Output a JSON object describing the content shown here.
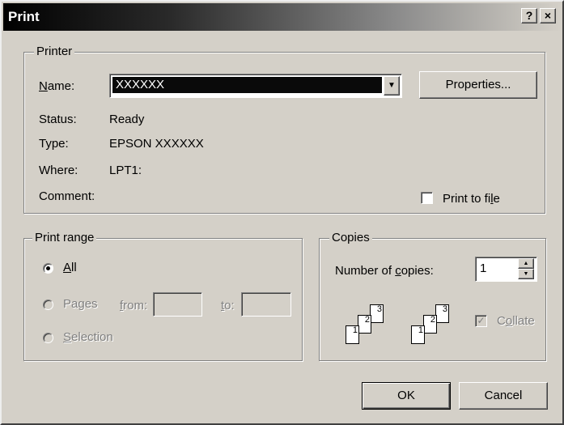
{
  "window": {
    "title": "Print",
    "help_glyph": "?",
    "close_glyph": "×"
  },
  "printer": {
    "group_label": "Printer",
    "name_label": "Name:",
    "name_value": "XXXXXX",
    "dropdown_glyph": "▼",
    "properties_label": "Properties...",
    "status_label": "Status:",
    "status_value": "Ready",
    "type_label": "Type:",
    "type_value": "EPSON XXXXXX",
    "where_label": "Where:",
    "where_value": "LPT1:",
    "comment_label": "Comment:",
    "print_to_file_label": "Print to file",
    "print_to_file_checked": false
  },
  "print_range": {
    "group_label": "Print range",
    "all_label": "All",
    "pages_label": "Pages",
    "from_label": "from:",
    "from_value": "",
    "to_label": "to:",
    "to_value": "",
    "selection_label": "Selection",
    "selected": "All"
  },
  "copies": {
    "group_label": "Copies",
    "number_label": "Number of copies:",
    "number_value": "1",
    "spin_up_glyph": "▲",
    "spin_down_glyph": "▼",
    "collate_label": "Collate",
    "collate_checked": true,
    "collate_check_glyph": "✓",
    "page_numbers": [
      "1",
      "2",
      "3"
    ]
  },
  "buttons": {
    "ok_label": "OK",
    "cancel_label": "Cancel"
  }
}
